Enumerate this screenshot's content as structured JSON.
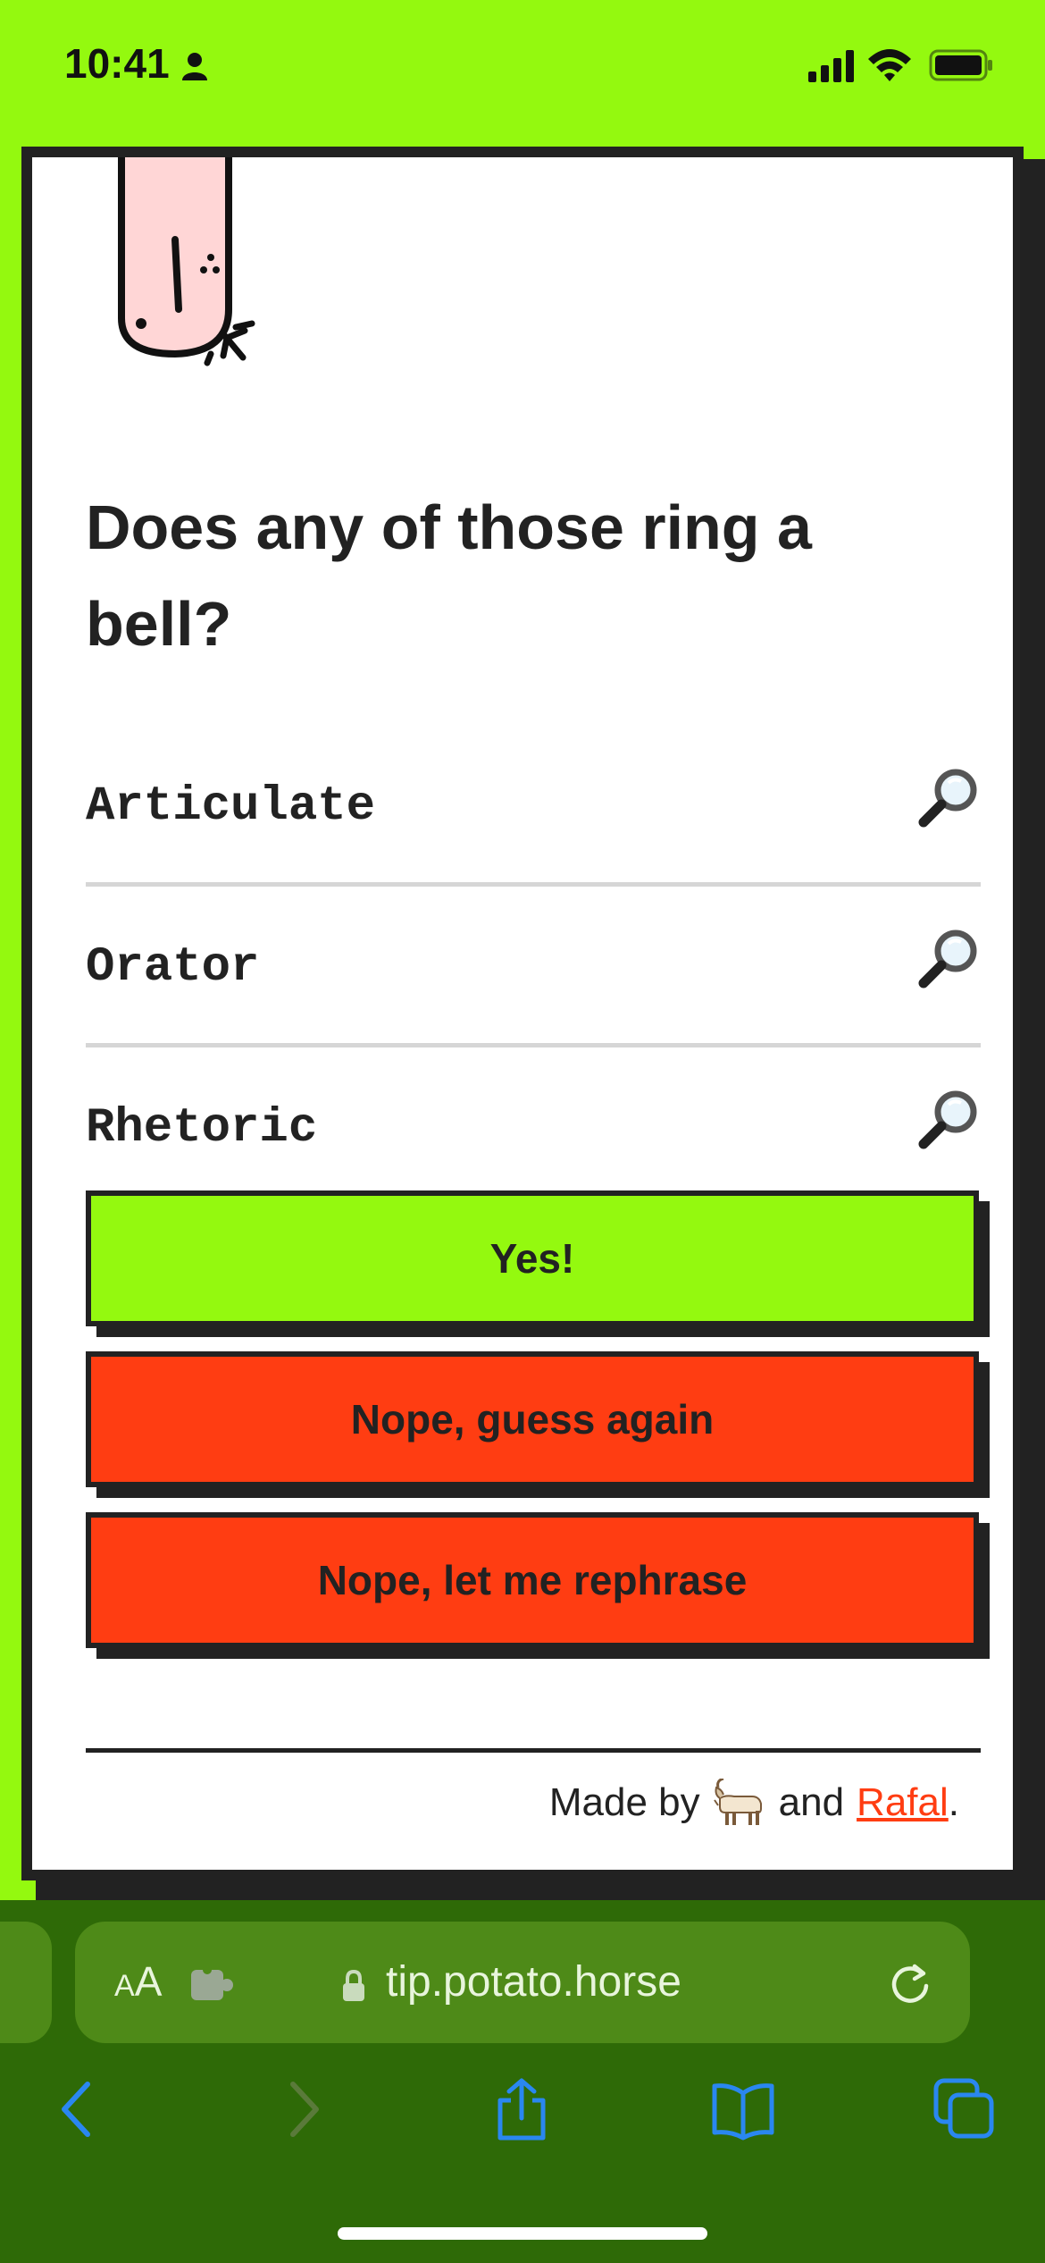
{
  "status_bar": {
    "time": "10:41",
    "icons": [
      "person-icon",
      "signal-icon",
      "wifi-icon",
      "battery-icon"
    ]
  },
  "colors": {
    "accent_green": "#94f90f",
    "alert_red": "#ff3d12",
    "ink": "#222222",
    "browser_bar": "#2e6a07"
  },
  "card": {
    "question": "Does any of those ring a bell?",
    "guesses": [
      {
        "word": "Articulate",
        "icon": "magnifier-icon"
      },
      {
        "word": "Orator",
        "icon": "magnifier-icon"
      },
      {
        "word": "Rhetoric",
        "icon": "magnifier-icon"
      }
    ],
    "buttons": {
      "yes": "Yes!",
      "guess_again": "Nope, guess again",
      "rephrase": "Nope, let me rephrase"
    },
    "footer": {
      "prefix": "Made by",
      "emoji": "goat-icon",
      "middle": "and",
      "link": "Rafal",
      "suffix": "."
    }
  },
  "browser": {
    "aa_small": "A",
    "aa_large": "A",
    "url": "tip.potato.horse"
  }
}
